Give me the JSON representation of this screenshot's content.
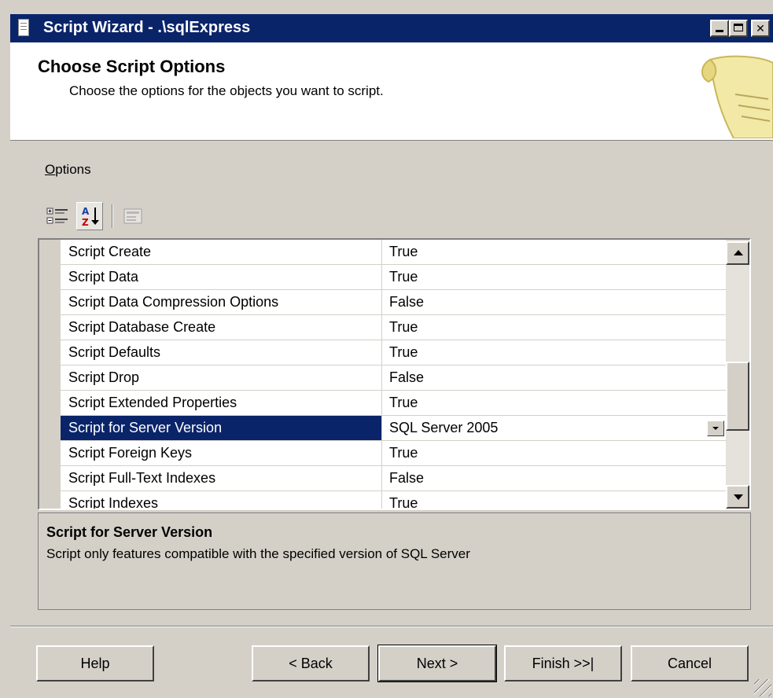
{
  "window": {
    "title": "Script Wizard - .\\sqlExpress"
  },
  "header": {
    "title": "Choose Script Options",
    "subtitle": "Choose the options for the objects you want to script."
  },
  "options_label": {
    "accel": "O",
    "rest": "ptions"
  },
  "toolbar": {
    "categorized_icon": "categorized-icon",
    "alphabetical_icon": "alphabetical-sort-icon",
    "property_pages_icon": "property-pages-icon"
  },
  "grid": {
    "rows": [
      {
        "name": "Script Create",
        "value": "True"
      },
      {
        "name": "Script Data",
        "value": "True"
      },
      {
        "name": "Script Data Compression Options",
        "value": "False"
      },
      {
        "name": "Script Database Create",
        "value": "True"
      },
      {
        "name": "Script Defaults",
        "value": "True"
      },
      {
        "name": "Script Drop",
        "value": "False"
      },
      {
        "name": "Script Extended Properties",
        "value": "True"
      },
      {
        "name": "Script for Server Version",
        "value": "SQL Server 2005",
        "selected": true
      },
      {
        "name": "Script Foreign Keys",
        "value": "True"
      },
      {
        "name": "Script Full-Text Indexes",
        "value": "False"
      },
      {
        "name": "Script Indexes",
        "value": "True"
      }
    ]
  },
  "description": {
    "title": "Script for Server Version",
    "text": "Script only features compatible with the specified version of SQL Server"
  },
  "buttons": {
    "help": "Help",
    "back": "< Back",
    "next": "Next >",
    "finish": "Finish >>|",
    "cancel": "Cancel"
  },
  "colors": {
    "title_bar": "#0a246a",
    "selection": "#0a246a",
    "face": "#d4d0c8"
  }
}
